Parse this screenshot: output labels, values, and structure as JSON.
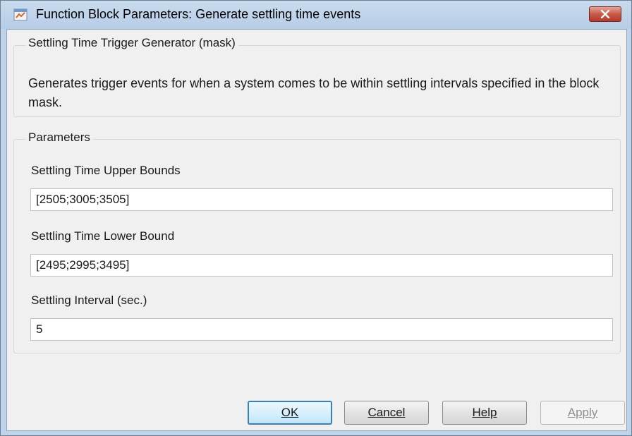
{
  "window": {
    "title": "Function Block Parameters: Generate settling time events",
    "app_icon": "simulink-block-icon",
    "close_icon": "close-icon"
  },
  "mask": {
    "group_title": "Settling Time Trigger Generator (mask)",
    "description": "Generates trigger events for when a system comes to be within settling intervals specified in the block mask."
  },
  "parameters": {
    "group_title": "Parameters",
    "fields": [
      {
        "label": "Settling Time Upper Bounds",
        "value": "[2505;3005;3505]"
      },
      {
        "label": "Settling Time Lower Bound",
        "value": "[2495;2995;3495]"
      },
      {
        "label": "Settling Interval (sec.)",
        "value": "5"
      }
    ]
  },
  "buttons": {
    "ok": "OK",
    "cancel": "Cancel",
    "help": "Help",
    "apply": "Apply"
  }
}
